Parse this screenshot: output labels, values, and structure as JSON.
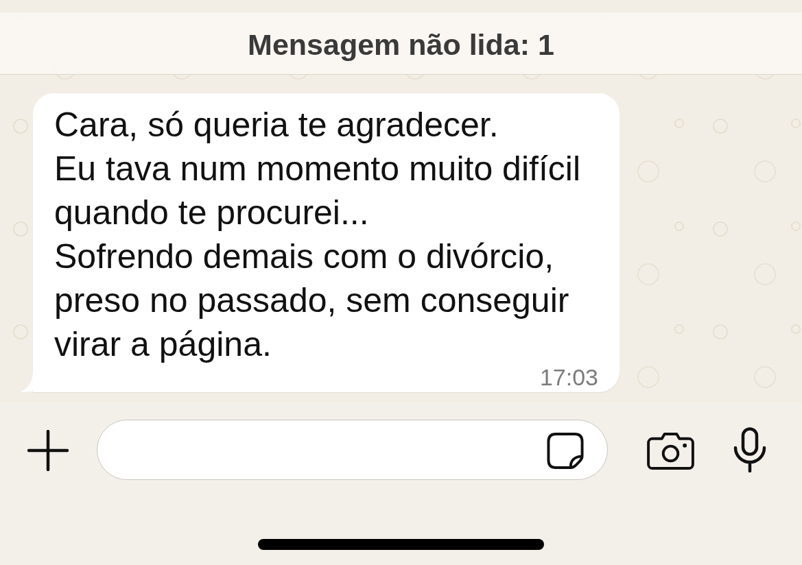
{
  "unread_banner": {
    "text": "Mensagem não lida: 1"
  },
  "messages": [
    {
      "paragraphs": [
        "Cara, só queria te agradecer.",
        "Eu tava num momento muito difícil quando te procurei...",
        "Sofrendo demais com o divórcio, preso no passado, sem conseguir virar a página."
      ],
      "time": "17:03"
    }
  ]
}
